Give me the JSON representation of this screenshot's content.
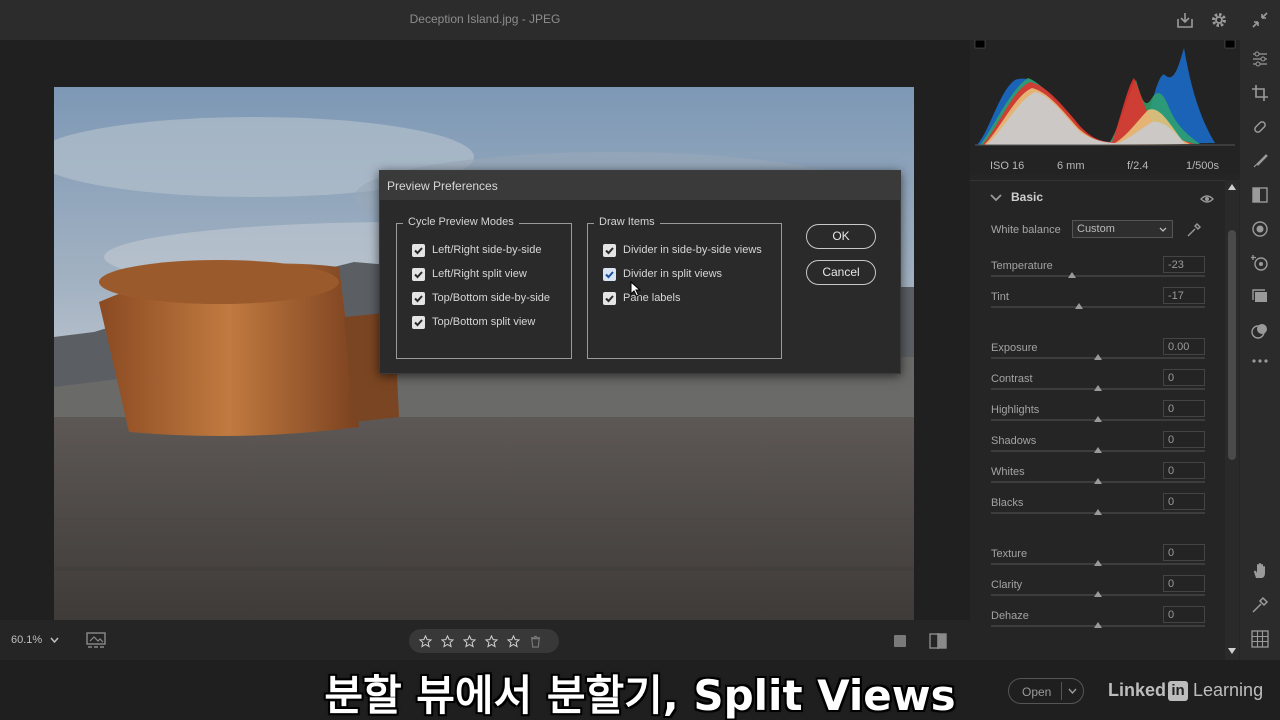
{
  "window": {
    "title": "Deception Island.jpg  -  JPEG"
  },
  "dialog": {
    "title": "Preview Preferences",
    "cycle_group": {
      "legend": "Cycle Preview Modes",
      "items": [
        {
          "label": "Left/Right side-by-side",
          "checked": true
        },
        {
          "label": "Left/Right split view",
          "checked": true
        },
        {
          "label": "Top/Bottom side-by-side",
          "checked": true
        },
        {
          "label": "Top/Bottom split view",
          "checked": true
        }
      ]
    },
    "draw_group": {
      "legend": "Draw Items",
      "items": [
        {
          "label": "Divider in side-by-side views",
          "checked": true
        },
        {
          "label": "Divider in split views",
          "checked": true
        },
        {
          "label": "Pane labels",
          "checked": true
        }
      ]
    },
    "ok_label": "OK",
    "cancel_label": "Cancel"
  },
  "bottom": {
    "zoom": "60.1%",
    "rating": 0,
    "max_rating": 5
  },
  "exif": {
    "iso": "ISO 16",
    "focal": "6 mm",
    "aperture": "f/2.4",
    "shutter": "1/500s"
  },
  "basic": {
    "title": "Basic",
    "white_balance_label": "White balance",
    "white_balance_value": "Custom",
    "sliders": [
      {
        "label": "Temperature",
        "value": "-23",
        "position": 0.38
      },
      {
        "label": "Tint",
        "value": "-17",
        "position": 0.41
      },
      {
        "label": "Exposure",
        "value": "0.00",
        "position": 0.5
      },
      {
        "label": "Contrast",
        "value": "0",
        "position": 0.5
      },
      {
        "label": "Highlights",
        "value": "0",
        "position": 0.5
      },
      {
        "label": "Shadows",
        "value": "0",
        "position": 0.5
      },
      {
        "label": "Whites",
        "value": "0",
        "position": 0.5
      },
      {
        "label": "Blacks",
        "value": "0",
        "position": 0.5
      },
      {
        "label": "Texture",
        "value": "0",
        "position": 0.5
      },
      {
        "label": "Clarity",
        "value": "0",
        "position": 0.5
      },
      {
        "label": "Dehaze",
        "value": "0",
        "position": 0.5
      }
    ]
  },
  "footer": {
    "open_label": "Open",
    "watermark_a": "Linked",
    "watermark_in": "in",
    "watermark_b": "Learning",
    "subtitle": "분할 뷰에서 분할기, Split Views"
  },
  "colors": {
    "panel": "#252525",
    "dialog": "#2a2a2a",
    "accent_checkbox": "#e4e4e4"
  }
}
